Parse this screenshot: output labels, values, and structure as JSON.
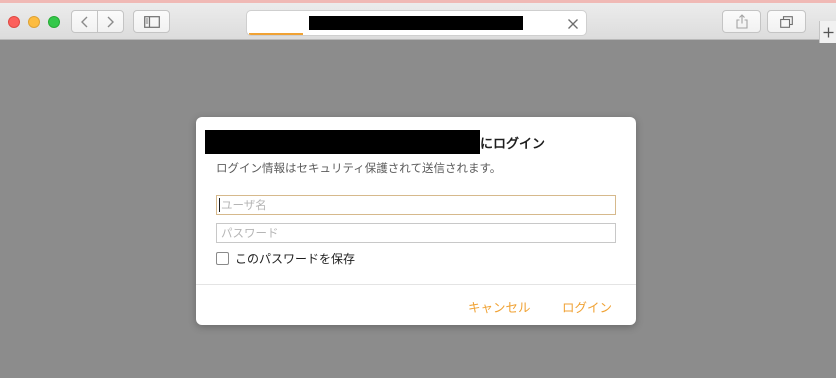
{
  "colors": {
    "accent": "#f0a234",
    "page_background": "#8c8c8c",
    "dialog_background": "#ffffff"
  },
  "toolbar": {
    "icons": [
      "back-icon",
      "forward-icon",
      "sidebar-icon",
      "share-icon",
      "tabs-icon",
      "plus-icon",
      "clear-icon"
    ]
  },
  "dialog": {
    "title_suffix": "にログイン",
    "subtitle": "ログイン情報はセキュリティ保護されて送信されます。",
    "username_placeholder": "ユーザ名",
    "password_placeholder": "パスワード",
    "remember_label": "このパスワードを保存",
    "cancel_label": "キャンセル",
    "login_label": "ログイン"
  }
}
